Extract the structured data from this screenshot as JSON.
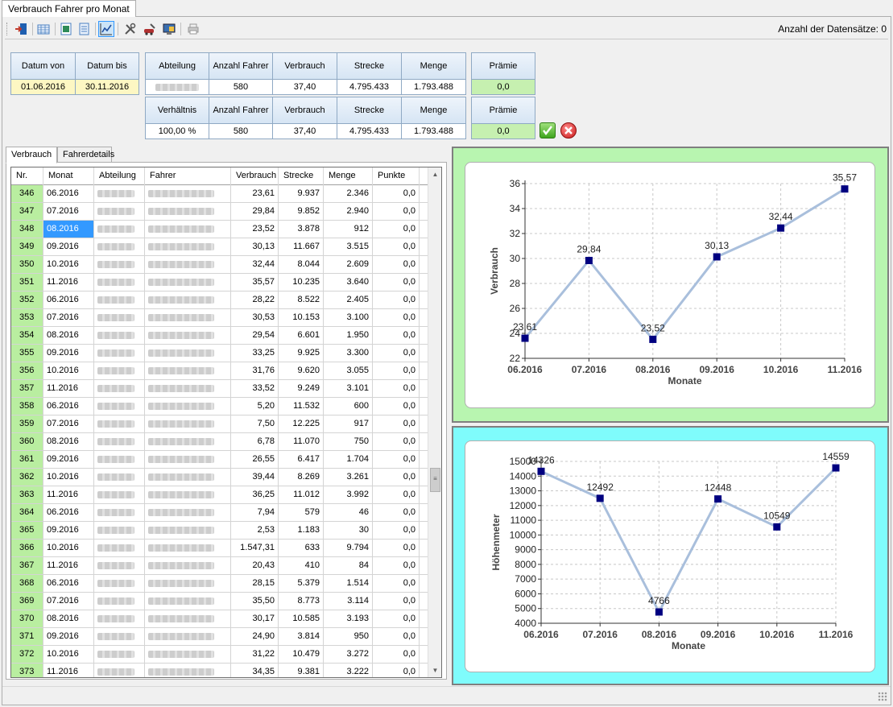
{
  "window": {
    "tab_title": "Verbrauch Fahrer pro Monat"
  },
  "toolbar": {
    "buttons": [
      {
        "name": "exit-door-icon",
        "color": "#c0392b"
      },
      {
        "name": "table-grid-icon",
        "color": "#4a7fc1"
      },
      {
        "name": "excel-export-icon",
        "color": "#2e8b57"
      },
      {
        "name": "document-icon",
        "color": "#4a7fc1"
      },
      {
        "name": "line-chart-icon",
        "color": "#1f4fa0",
        "active": true
      },
      {
        "name": "tools-icon",
        "color": "#555555"
      },
      {
        "name": "car-settings-icon",
        "color": "#b03030"
      },
      {
        "name": "monitor-report-icon",
        "color": "#3a6fb0"
      },
      {
        "name": "print-icon",
        "color": "#999999"
      }
    ],
    "record_count_label": "Anzahl der Datensätze: 0"
  },
  "filter": {
    "headers": [
      "Datum von",
      "Datum bis",
      "Abteilung",
      "Anzahl Fahrer",
      "Verbrauch",
      "Strecke",
      "Menge",
      "Prämie"
    ],
    "row1": {
      "datum_von": "01.06.2016",
      "datum_bis": "30.11.2016",
      "anzahl_fahrer": "580",
      "verbrauch": "37,40",
      "strecke": "4.795.433",
      "menge": "1.793.488",
      "praemie": "0,0"
    },
    "headers2": [
      "Verhältnis",
      "Anzahl Fahrer",
      "Verbrauch",
      "Strecke",
      "Menge",
      "Prämie"
    ],
    "row2": {
      "verhaeltnis": "100,00 %",
      "anzahl_fahrer": "580",
      "verbrauch": "37,40",
      "strecke": "4.795.433",
      "menge": "1.793.488",
      "praemie": "0,0"
    }
  },
  "tabs": [
    {
      "label": "Verbrauch",
      "active": true
    },
    {
      "label": "Fahrerdetails",
      "active": false
    }
  ],
  "table": {
    "columns": [
      "Nr.",
      "Monat",
      "Abteilung",
      "Fahrer",
      "Verbrauch",
      "Strecke",
      "Menge",
      "Punkte"
    ],
    "rows": [
      [
        "346",
        "06.2016",
        "23,61",
        "9.937",
        "2.346",
        "0,0"
      ],
      [
        "347",
        "07.2016",
        "29,84",
        "9.852",
        "2.940",
        "0,0"
      ],
      [
        "348",
        "08.2016",
        "23,52",
        "3.878",
        "912",
        "0,0"
      ],
      [
        "349",
        "09.2016",
        "30,13",
        "11.667",
        "3.515",
        "0,0"
      ],
      [
        "350",
        "10.2016",
        "32,44",
        "8.044",
        "2.609",
        "0,0"
      ],
      [
        "351",
        "11.2016",
        "35,57",
        "10.235",
        "3.640",
        "0,0"
      ],
      [
        "352",
        "06.2016",
        "28,22",
        "8.522",
        "2.405",
        "0,0"
      ],
      [
        "353",
        "07.2016",
        "30,53",
        "10.153",
        "3.100",
        "0,0"
      ],
      [
        "354",
        "08.2016",
        "29,54",
        "6.601",
        "1.950",
        "0,0"
      ],
      [
        "355",
        "09.2016",
        "33,25",
        "9.925",
        "3.300",
        "0,0"
      ],
      [
        "356",
        "10.2016",
        "31,76",
        "9.620",
        "3.055",
        "0,0"
      ],
      [
        "357",
        "11.2016",
        "33,52",
        "9.249",
        "3.101",
        "0,0"
      ],
      [
        "358",
        "06.2016",
        "5,20",
        "11.532",
        "600",
        "0,0"
      ],
      [
        "359",
        "07.2016",
        "7,50",
        "12.225",
        "917",
        "0,0"
      ],
      [
        "360",
        "08.2016",
        "6,78",
        "11.070",
        "750",
        "0,0"
      ],
      [
        "361",
        "09.2016",
        "26,55",
        "6.417",
        "1.704",
        "0,0"
      ],
      [
        "362",
        "10.2016",
        "39,44",
        "8.269",
        "3.261",
        "0,0"
      ],
      [
        "363",
        "11.2016",
        "36,25",
        "11.012",
        "3.992",
        "0,0"
      ],
      [
        "364",
        "06.2016",
        "7,94",
        "579",
        "46",
        "0,0"
      ],
      [
        "365",
        "09.2016",
        "2,53",
        "1.183",
        "30",
        "0,0"
      ],
      [
        "366",
        "10.2016",
        "1.547,31",
        "633",
        "9.794",
        "0,0"
      ],
      [
        "367",
        "11.2016",
        "20,43",
        "410",
        "84",
        "0,0"
      ],
      [
        "368",
        "06.2016",
        "28,15",
        "5.379",
        "1.514",
        "0,0"
      ],
      [
        "369",
        "07.2016",
        "35,50",
        "8.773",
        "3.114",
        "0,0"
      ],
      [
        "370",
        "08.2016",
        "30,17",
        "10.585",
        "3.193",
        "0,0"
      ],
      [
        "371",
        "09.2016",
        "24,90",
        "3.814",
        "950",
        "0,0"
      ],
      [
        "372",
        "10.2016",
        "31,22",
        "10.479",
        "3.272",
        "0,0"
      ],
      [
        "373",
        "11.2016",
        "34,35",
        "9.381",
        "3.222",
        "0,0"
      ]
    ],
    "selected_row": 2
  },
  "chart_data": [
    {
      "type": "line",
      "categories": [
        "06.2016",
        "07.2016",
        "08.2016",
        "09.2016",
        "10.2016",
        "11.2016"
      ],
      "values": [
        23.61,
        29.84,
        23.52,
        30.13,
        32.44,
        35.57
      ],
      "value_labels": [
        "23,61",
        "29,84",
        "23,52",
        "30,13",
        "32,44",
        "35,57"
      ],
      "xlabel": "Monate",
      "ylabel": "Verbrauch",
      "ylim": [
        22,
        36
      ],
      "yticks": [
        22,
        24,
        26,
        28,
        30,
        32,
        34,
        36
      ],
      "grid": true,
      "panel_color": "#b8f5b0",
      "line_color": "#a9bfdc",
      "marker_color": "#000080"
    },
    {
      "type": "line",
      "categories": [
        "06.2016",
        "07.2016",
        "08.2016",
        "09.2016",
        "10.2016",
        "11.2016"
      ],
      "values": [
        14326,
        12492,
        4766,
        12448,
        10549,
        14559
      ],
      "value_labels": [
        "14326",
        "12492",
        "4766",
        "12448",
        "10549",
        "14559"
      ],
      "xlabel": "Monate",
      "ylabel": "Höhenmeter",
      "ylim": [
        4000,
        15000
      ],
      "yticks": [
        4000,
        5000,
        6000,
        7000,
        8000,
        9000,
        10000,
        11000,
        12000,
        13000,
        14000,
        15000
      ],
      "grid": true,
      "panel_color": "#7ffcfc",
      "line_color": "#a9bfdc",
      "marker_color": "#000080"
    }
  ]
}
